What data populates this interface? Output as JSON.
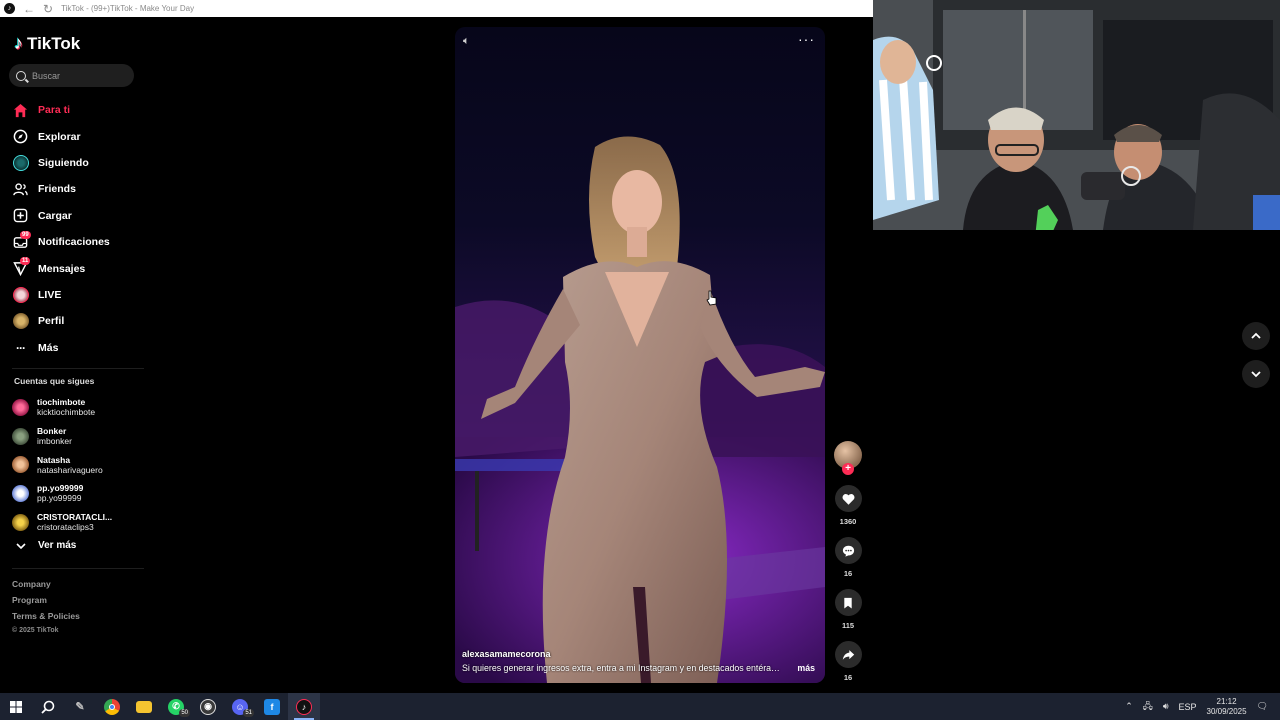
{
  "browser": {
    "tab_title": "TikTok - (99+)TikTok - Make Your Day"
  },
  "brand": {
    "logo_text": "TikTok",
    "accent": "#fe2c55",
    "cyan": "#25f4ee"
  },
  "search": {
    "placeholder": "Buscar"
  },
  "nav": [
    {
      "label": "Para ti",
      "icon": "home-icon",
      "active": true
    },
    {
      "label": "Explorar",
      "icon": "compass-icon"
    },
    {
      "label": "Siguiendo",
      "icon": "following-avatar-icon"
    },
    {
      "label": "Friends",
      "icon": "friends-icon"
    },
    {
      "label": "Cargar",
      "icon": "upload-icon"
    },
    {
      "label": "Notificaciones",
      "icon": "inbox-icon",
      "badge": "99"
    },
    {
      "label": "Mensajes",
      "icon": "send-icon",
      "badge": "11"
    },
    {
      "label": "LIVE",
      "icon": "live-icon"
    },
    {
      "label": "Perfil",
      "icon": "profile-avatar-icon"
    },
    {
      "label": "Más",
      "icon": "more-dots-icon"
    }
  ],
  "following": {
    "title": "Cuentas que sigues",
    "accounts": [
      {
        "name": "tiochimbote",
        "handle": "kicktiochimbote",
        "color": "#c2185b"
      },
      {
        "name": "Bonker",
        "handle": "imbonker",
        "color": "#556b4f"
      },
      {
        "name": "Natasha",
        "handle": "natasharivaguero",
        "color": "#c9885a"
      },
      {
        "name": "pp.yo99999",
        "handle": "pp.yo99999",
        "color": "#e8eefc"
      },
      {
        "name": "CRISTORATACLI...",
        "handle": "cristorataclips3",
        "color": "#c7a02a"
      }
    ],
    "see_more": "Ver más"
  },
  "footer": {
    "links": [
      "Company",
      "Program",
      "Terms & Policies"
    ],
    "copyright": "© 2025 TikTok"
  },
  "video": {
    "author": "alexasamamecorona",
    "caption": "Si quieres generar ingresos extra, entra a mi Instagram y en destacados entérate ...",
    "more": "más"
  },
  "actions": {
    "likes": "1360",
    "comments": "16",
    "saves": "115",
    "shares": "16"
  },
  "taskbar": {
    "whatsapp_badge": "50",
    "discord_badge": "51",
    "language": "ESP",
    "time": "21:12",
    "date": "30/09/2025"
  }
}
